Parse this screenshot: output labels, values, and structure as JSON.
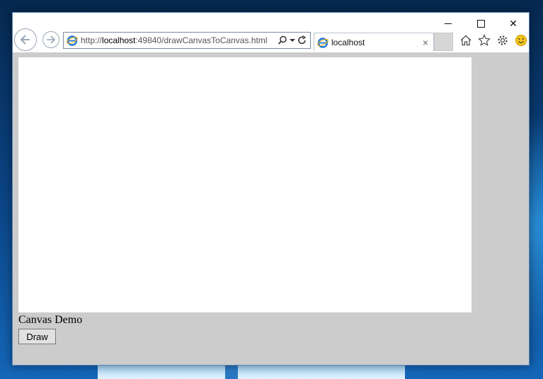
{
  "browser": {
    "address": {
      "url_prefix": "http://",
      "url_host": "localhost",
      "url_rest": ":49840/drawCanvasToCanvas.html"
    },
    "tab": {
      "title": "localhost",
      "close_glyph": "×"
    },
    "icons": {
      "back": "back-arrow-icon",
      "forward": "forward-arrow-icon",
      "search": "search-icon",
      "dropdown": "dropdown-icon",
      "refresh": "refresh-icon",
      "home": "home-icon",
      "favorites": "star-icon",
      "settings": "gear-icon",
      "feedback": "smiley-icon"
    },
    "caption": {
      "close_glyph": "✕"
    }
  },
  "page": {
    "label": "Canvas Demo",
    "draw_button": "Draw"
  },
  "colors": {
    "viewport_bg": "#cccccc",
    "canvas_bg": "#ffffff",
    "ie_blue": "#1e78d2"
  }
}
